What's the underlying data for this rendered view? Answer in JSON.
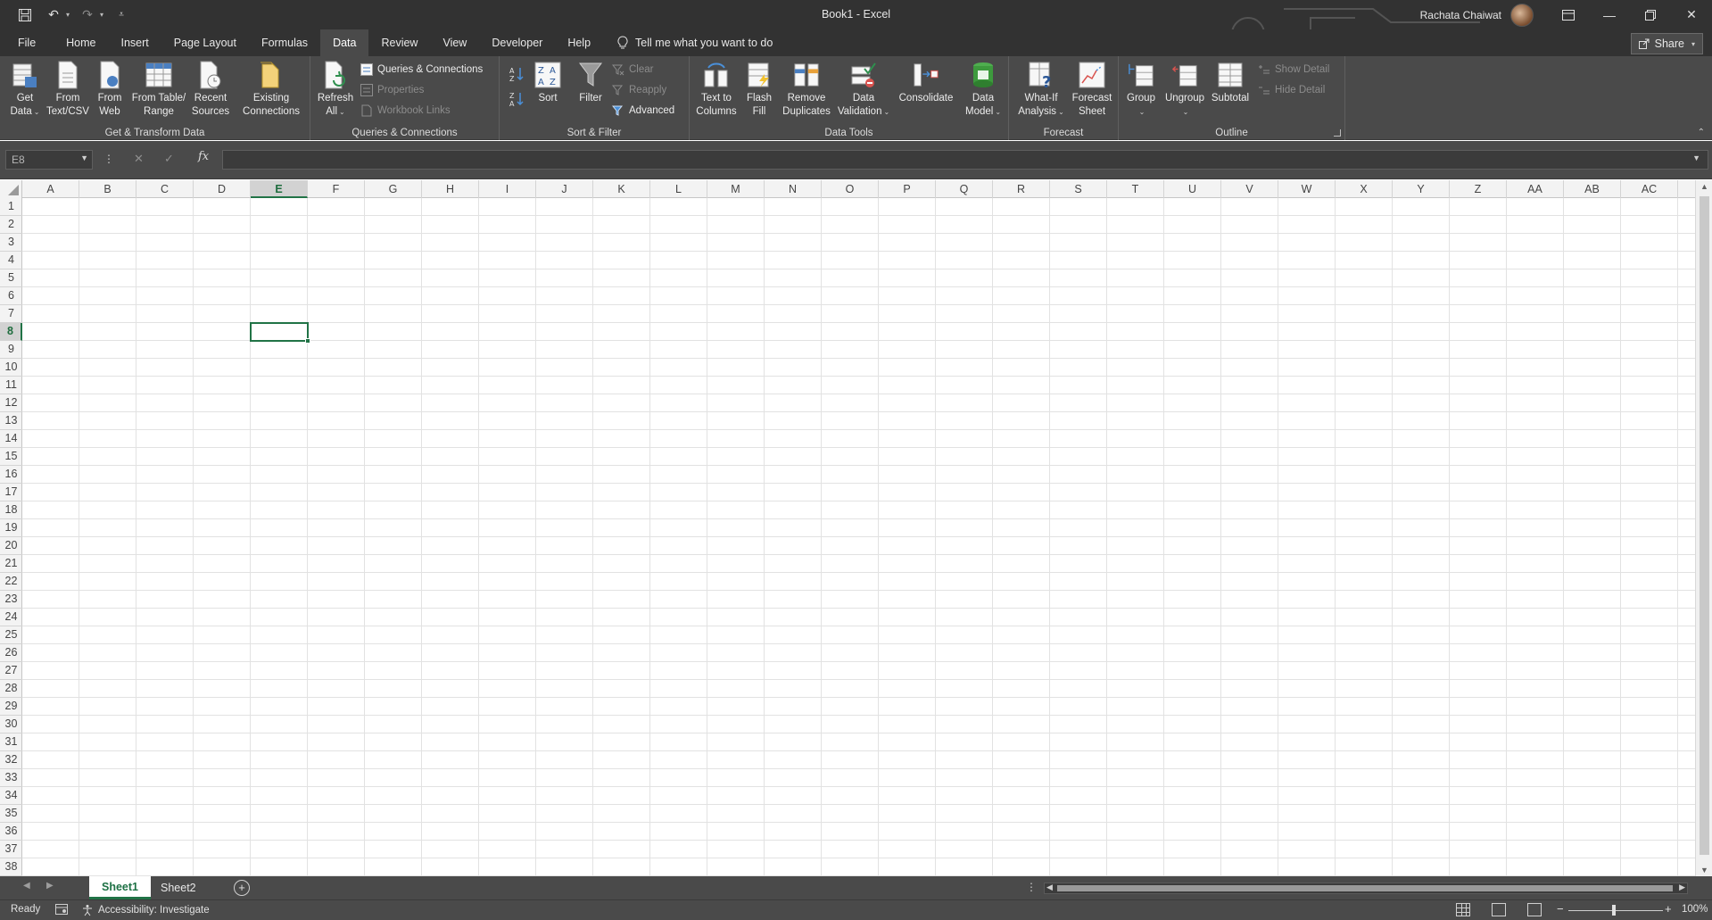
{
  "window": {
    "title": "Book1  -  Excel",
    "user_name": "Rachata Chaiwat"
  },
  "tabs": [
    {
      "label": "File"
    },
    {
      "label": "Home"
    },
    {
      "label": "Insert"
    },
    {
      "label": "Page Layout"
    },
    {
      "label": "Formulas"
    },
    {
      "label": "Data"
    },
    {
      "label": "Review"
    },
    {
      "label": "View"
    },
    {
      "label": "Developer"
    },
    {
      "label": "Help"
    }
  ],
  "active_tab": "Data",
  "tell_me": "Tell me what you want to do",
  "share_label": "Share",
  "ribbon": {
    "get_transform": {
      "label": "Get & Transform Data",
      "get_data_1": "Get",
      "get_data_2": "Data",
      "from_text_1": "From",
      "from_text_2": "Text/CSV",
      "from_web_1": "From",
      "from_web_2": "Web",
      "from_table_1": "From Table/",
      "from_table_2": "Range",
      "recent_1": "Recent",
      "recent_2": "Sources",
      "existing_1": "Existing",
      "existing_2": "Connections"
    },
    "queries": {
      "label": "Queries & Connections",
      "refresh_1": "Refresh",
      "refresh_2": "All",
      "queries_connections": "Queries & Connections",
      "properties": "Properties",
      "workbook_links": "Workbook Links"
    },
    "sort_filter": {
      "label": "Sort & Filter",
      "sort": "Sort",
      "filter": "Filter",
      "clear": "Clear",
      "reapply": "Reapply",
      "advanced": "Advanced"
    },
    "data_tools": {
      "label": "Data Tools",
      "text_to_1": "Text to",
      "text_to_2": "Columns",
      "flash_1": "Flash",
      "flash_2": "Fill",
      "remove_1": "Remove",
      "remove_2": "Duplicates",
      "validation_1": "Data",
      "validation_2": "Validation",
      "consolidate": "Consolidate",
      "model_1": "Data",
      "model_2": "Model"
    },
    "forecast": {
      "label": "Forecast",
      "whatif_1": "What-If",
      "whatif_2": "Analysis",
      "sheet_1": "Forecast",
      "sheet_2": "Sheet"
    },
    "outline": {
      "label": "Outline",
      "group": "Group",
      "ungroup": "Ungroup",
      "subtotal": "Subtotal",
      "show_detail": "Show Detail",
      "hide_detail": "Hide Detail"
    }
  },
  "formula_bar": {
    "name_box": "E8",
    "fx": "fx",
    "value": ""
  },
  "grid": {
    "columns": [
      "A",
      "B",
      "C",
      "D",
      "E",
      "F",
      "G",
      "H",
      "I",
      "J",
      "K",
      "L",
      "M",
      "N",
      "O",
      "P",
      "Q",
      "R",
      "S",
      "T",
      "U",
      "V",
      "W",
      "X",
      "Y",
      "Z",
      "AA",
      "AB",
      "AC"
    ],
    "rows": [
      "1",
      "2",
      "3",
      "4",
      "5",
      "6",
      "7",
      "8",
      "9",
      "10",
      "11",
      "12",
      "13",
      "14",
      "15",
      "16",
      "17",
      "18",
      "19",
      "20",
      "21",
      "22",
      "23",
      "24",
      "25",
      "26",
      "27",
      "28",
      "29",
      "30",
      "31",
      "32",
      "33",
      "34",
      "35",
      "36",
      "37",
      "38"
    ],
    "active_column": "E",
    "active_row": "8"
  },
  "sheets": [
    {
      "label": "Sheet1"
    },
    {
      "label": "Sheet2"
    }
  ],
  "active_sheet": "Sheet1",
  "status": {
    "ready": "Ready",
    "accessibility": "Accessibility: Investigate",
    "zoom": "100%"
  }
}
